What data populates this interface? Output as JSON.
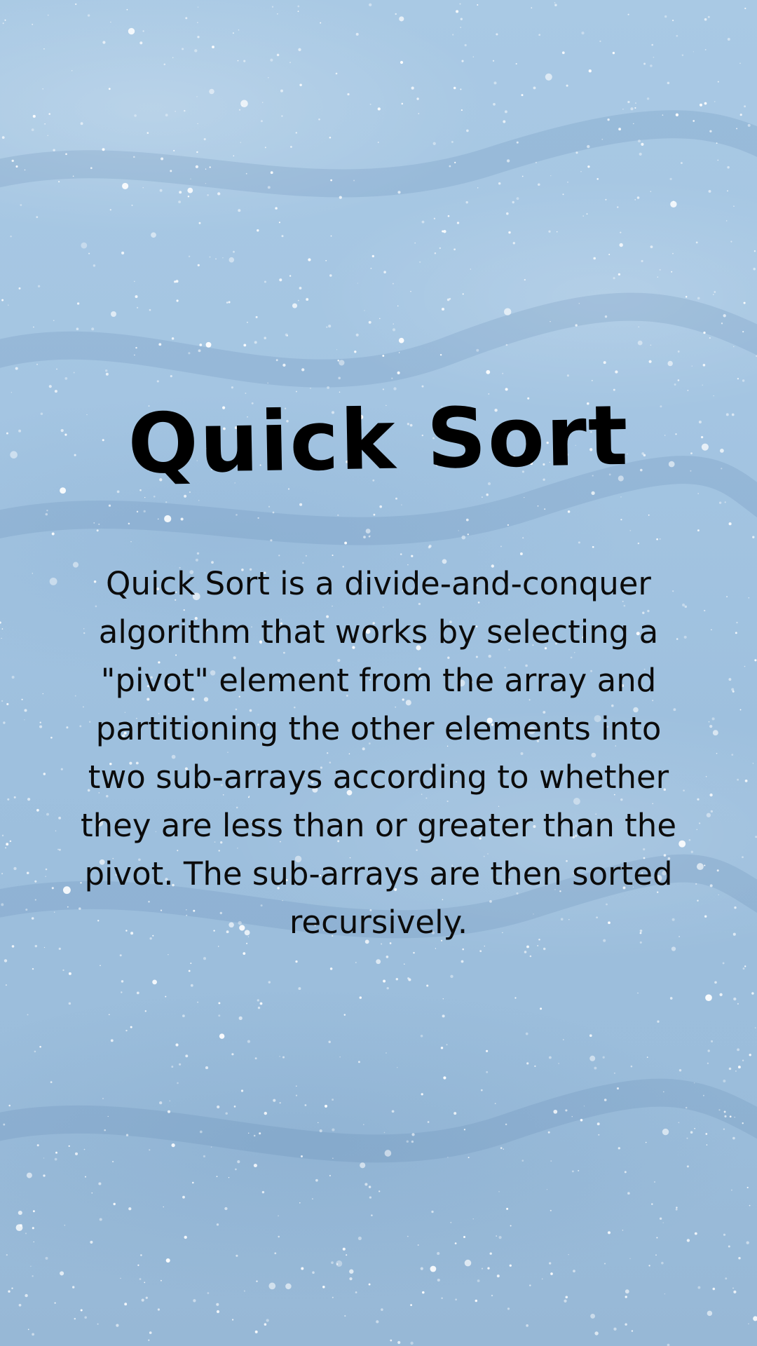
{
  "background": {
    "texture": "glittery light blue watercolor",
    "base_color": "#a4c5e2"
  },
  "title": "Quick Sort",
  "description": "Quick Sort is a divide-and-conquer algorithm that works by selecting a \"pivot\" element from the array and partitioning the other elements into two sub-arrays according to whether they are less than or greater than the pivot. The sub-arrays are then sorted recursively."
}
